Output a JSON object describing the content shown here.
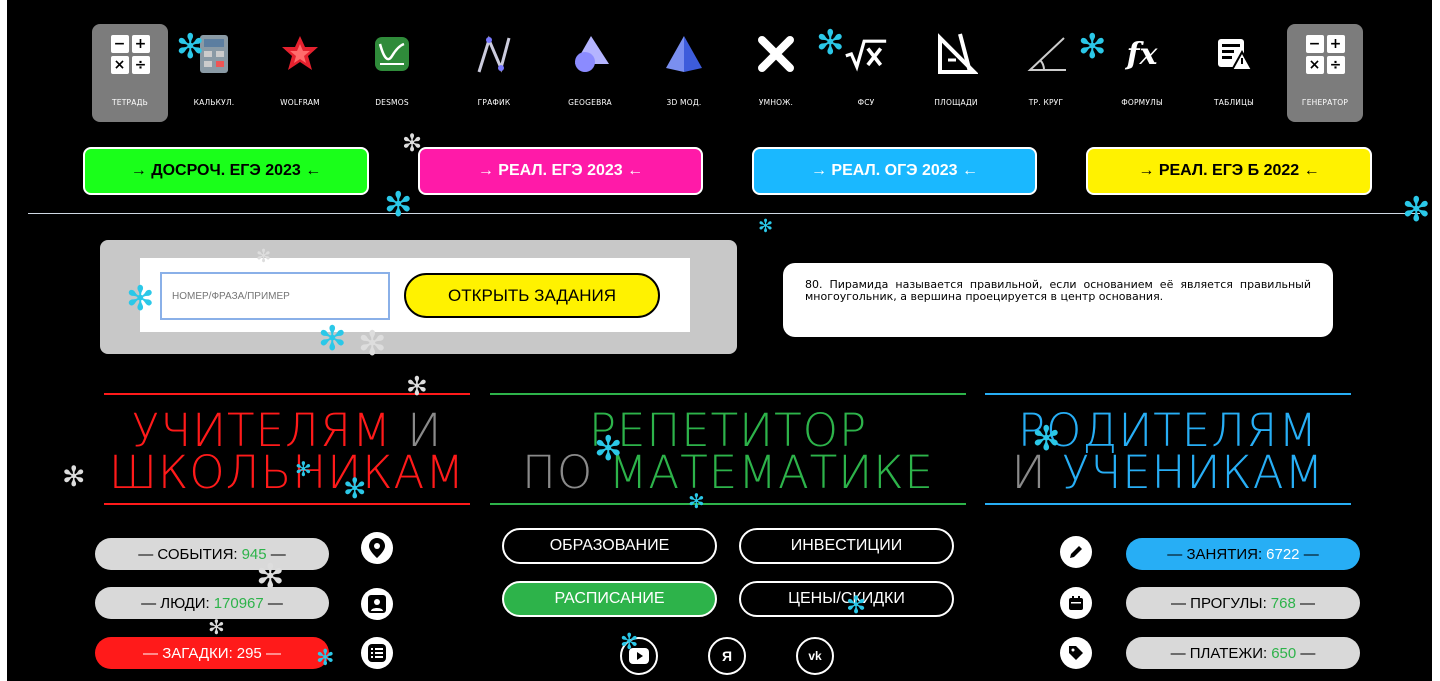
{
  "toolbar": {
    "items": [
      {
        "label": "ТЕТРАДЬ",
        "icon": "calculator-grid-icon"
      },
      {
        "label": "КАЛЬКУЛ.",
        "icon": "calculator-icon"
      },
      {
        "label": "WOLFRAM",
        "icon": "wolfram-icon"
      },
      {
        "label": "DESMOS",
        "icon": "desmos-icon"
      },
      {
        "label": "ГРАФИК",
        "icon": "graph-icon"
      },
      {
        "label": "GEOGEBRA",
        "icon": "geogebra-icon"
      },
      {
        "label": "3D МОД.",
        "icon": "pyramid-icon"
      },
      {
        "label": "УМНОЖ.",
        "icon": "multiply-icon"
      },
      {
        "label": "ФСУ",
        "icon": "sqrt-icon"
      },
      {
        "label": "ПЛОЩАДИ",
        "icon": "set-square-icon"
      },
      {
        "label": "ТР. КРУГ",
        "icon": "angle-icon"
      },
      {
        "label": "ФОРМУЛЫ",
        "icon": "fx-icon"
      },
      {
        "label": "ТАБЛИЦЫ",
        "icon": "table-warning-icon"
      },
      {
        "label": "ГЕНЕРАТОР",
        "icon": "calculator-grid-icon"
      }
    ],
    "calc_keys": [
      "−",
      "+",
      "×",
      "÷"
    ]
  },
  "exams": [
    {
      "label": "→ ДОСРОЧ. ЕГЭ 2023 ←",
      "color": "#1aff1a",
      "text": "#000"
    },
    {
      "label": "→ РЕАЛ. ЕГЭ 2023 ←",
      "color": "#ff1aa8",
      "text": "#fff"
    },
    {
      "label": "→ РЕАЛ. ОГЭ 2023 ←",
      "color": "#1ab8ff",
      "text": "#fff"
    },
    {
      "label": "→ РЕАЛ. ЕГЭ Б 2022 ←",
      "color": "#fff200",
      "text": "#000"
    }
  ],
  "search": {
    "placeholder": "НОМЕР/ФРАЗА/ПРИМЕР",
    "button": "ОТКРЫТЬ ЗАДАНИЯ"
  },
  "fact": "80. Пирамида называется правильной, если основанием её является правильный многоугольник, а вершина проецируется в центр основания.",
  "sections": {
    "left": {
      "line1a": "УЧИТЕЛЯМ",
      "line1b": "И",
      "line2": "ШКОЛЬНИКАМ",
      "color": "#ff1a1a"
    },
    "center": {
      "line1": "РЕПЕТИТОР",
      "line2a": "ПО",
      "line2b": "МАТЕМАТИКЕ",
      "color": "#2db34a"
    },
    "right": {
      "line1": "РОДИТЕЛЯМ",
      "line2a": "И",
      "line2b": "УЧЕНИКАМ",
      "color": "#27aef5"
    }
  },
  "left_stats": [
    {
      "label": "— СОБЫТИЯ:",
      "value": "945",
      "tail": "—"
    },
    {
      "label": "— ЛЮДИ:",
      "value": "170967",
      "tail": "—"
    },
    {
      "label": "— ЗАГАДКИ:",
      "value": "295",
      "tail": "—"
    }
  ],
  "right_stats": [
    {
      "label": "— ЗАНЯТИЯ:",
      "value": "6722",
      "tail": "—"
    },
    {
      "label": "— ПРОГУЛЫ:",
      "value": "768",
      "tail": "—"
    },
    {
      "label": "— ПЛАТЕЖИ:",
      "value": "650",
      "tail": "—"
    }
  ],
  "center_buttons": {
    "education": "ОБРАЗОВАНИЕ",
    "investments": "ИНВЕСТИЦИИ",
    "schedule": "РАСПИСАНИЕ",
    "prices": "ЦЕНЫ/СКИДКИ"
  },
  "social": {
    "yandex": "Я",
    "vk": "vk"
  },
  "snowflake": "✻"
}
